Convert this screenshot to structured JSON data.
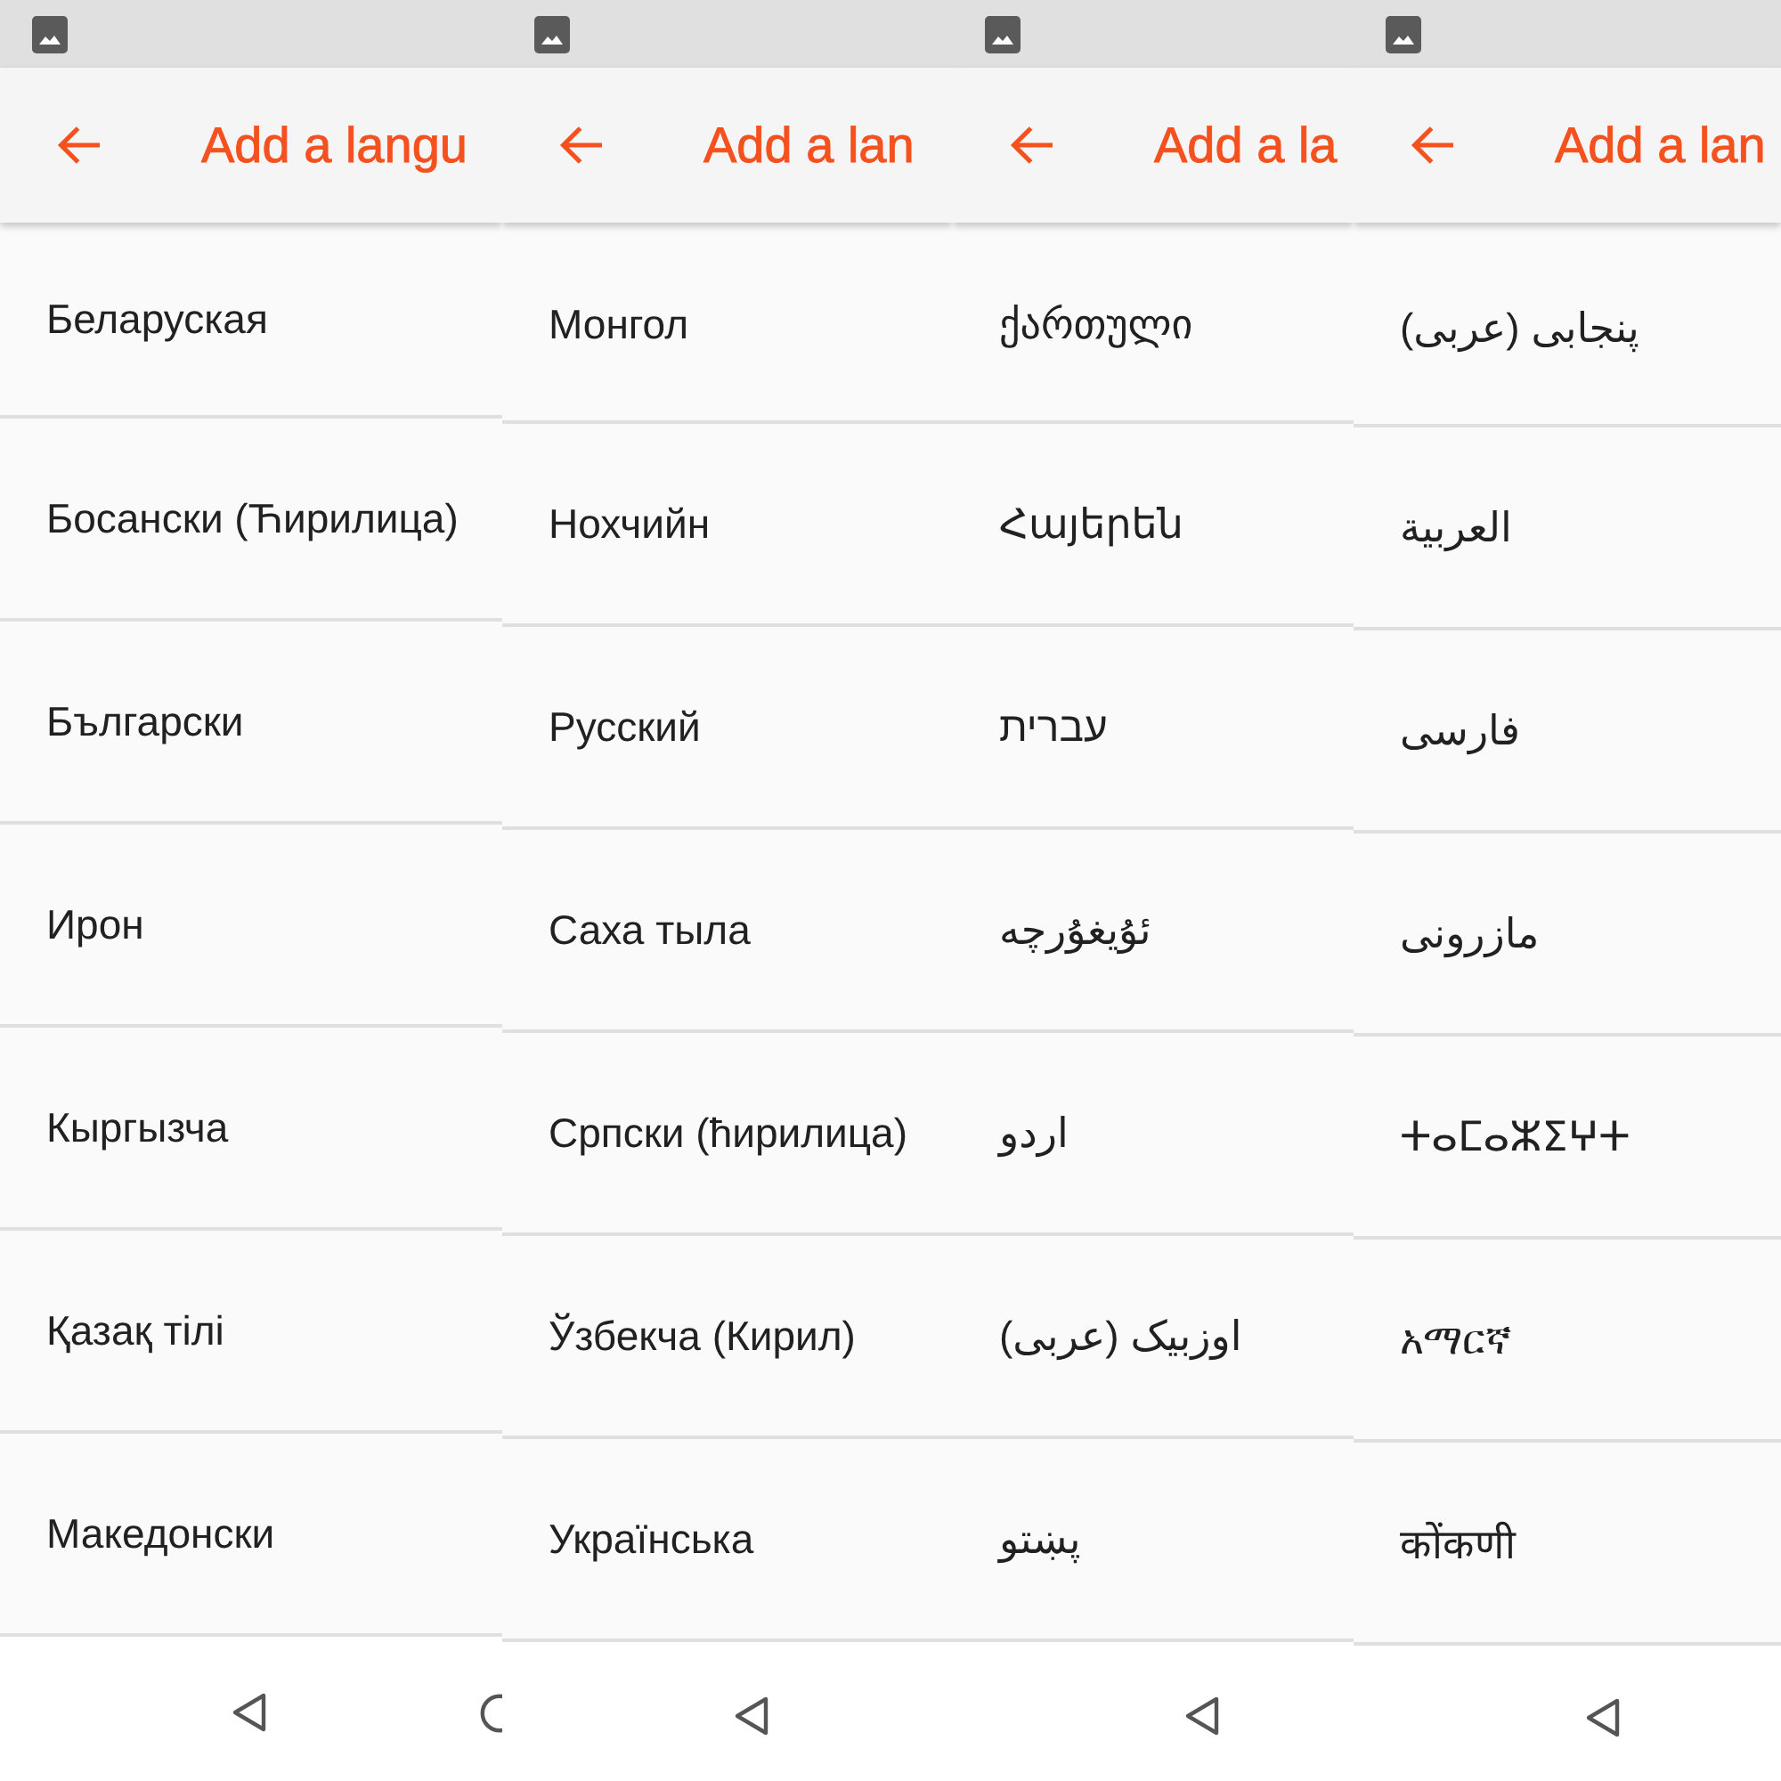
{
  "screens": [
    {
      "app_bar": {
        "title": "Add a langu"
      },
      "languages": [
        "Беларуская",
        "Босански (Ћирилица)",
        "Български",
        "Ирон",
        "Кыргызча",
        "Қазақ тілі",
        "Македонски"
      ],
      "nav_bar": {
        "buttons": [
          {
            "kind": "back"
          },
          {
            "kind": "home"
          }
        ]
      }
    },
    {
      "app_bar": {
        "title": "Add a lan"
      },
      "languages": [
        "Монгол",
        "Нохчийн",
        "Русский",
        "Саха тыла",
        "Српски (ћирилица)",
        "Ўзбекча (Кирил)",
        "Українська"
      ],
      "nav_bar": {
        "buttons": [
          {
            "kind": "back"
          }
        ]
      }
    },
    {
      "app_bar": {
        "title": "Add a la"
      },
      "languages": [
        "ქართული",
        "Հայերեն",
        "עברית",
        "ئۇيغۇرچە",
        "اردو",
        "اوزبیک (عربی)",
        "پښتو"
      ],
      "nav_bar": {
        "buttons": [
          {
            "kind": "back"
          }
        ]
      }
    },
    {
      "app_bar": {
        "title": "Add a lan"
      },
      "languages": [
        "پنجابی (عربی)",
        "العربية",
        "فارسی",
        "مازرونی",
        "ⵜⴰⵎⴰⵣⵉⵖⵜ",
        "አማርኛ",
        "कोंकणी"
      ],
      "nav_bar": {
        "buttons": [
          {
            "kind": "back"
          }
        ]
      }
    }
  ]
}
